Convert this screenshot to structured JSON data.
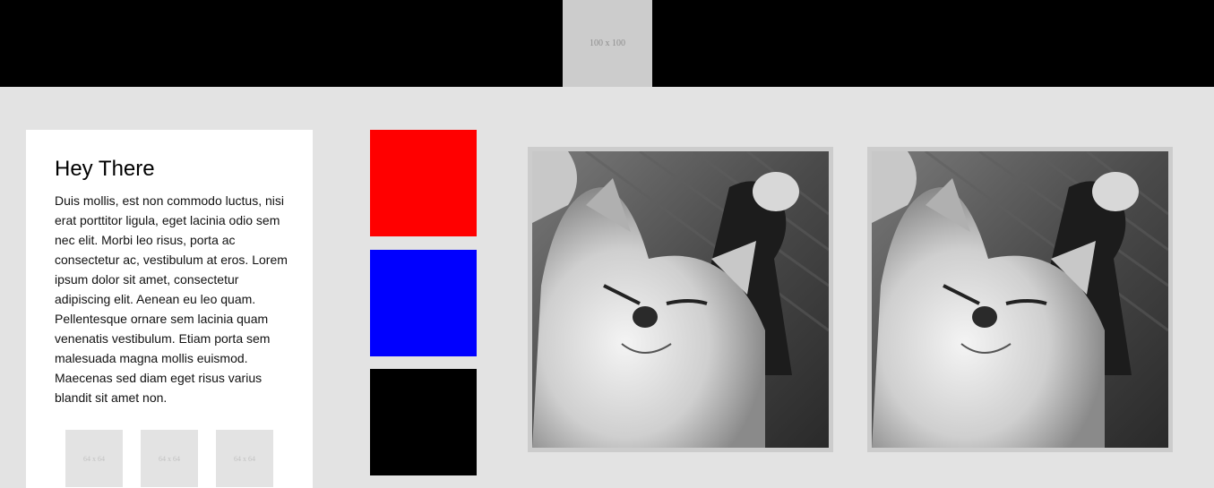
{
  "header": {
    "logo_placeholder": "100 x 100"
  },
  "card": {
    "title": "Hey There",
    "body": "Duis mollis, est non commodo luctus, nisi erat porttitor ligula, eget lacinia odio sem nec elit. Morbi leo risus, porta ac consectetur ac, vestibulum at eros. Lorem ipsum dolor sit amet, consectetur adipiscing elit. Aenean eu leo quam. Pellentesque ornare sem lacinia quam venenatis vestibulum. Etiam porta sem malesuada magna mollis euismod. Maecenas sed diam eget risus varius blandit sit amet non.",
    "thumbnails": [
      "64 x 64",
      "64 x 64",
      "64 x 64"
    ]
  },
  "swatches": [
    {
      "color": "#ff0000"
    },
    {
      "color": "#0000ff"
    },
    {
      "color": "#000000"
    }
  ],
  "photos": [
    {
      "subject": "sleeping-kitten-grayscale"
    },
    {
      "subject": "sleeping-kitten-grayscale"
    }
  ]
}
